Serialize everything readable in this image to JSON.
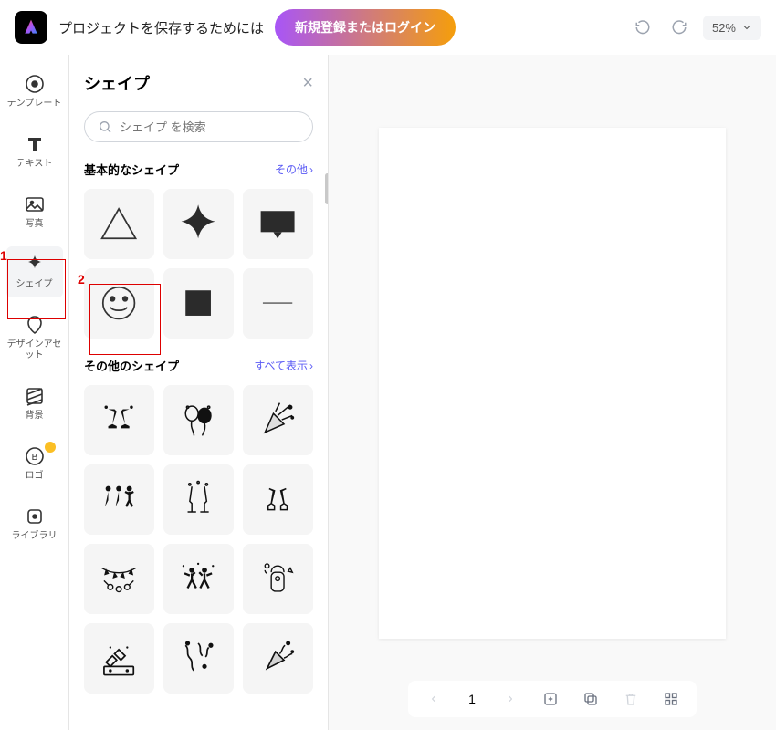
{
  "topbar": {
    "save_msg": "プロジェクトを保存するためには",
    "cta": "新規登録またはログイン",
    "zoom": "52%"
  },
  "rail": {
    "items": [
      {
        "label": "テンプレート"
      },
      {
        "label": "テキスト"
      },
      {
        "label": "写真"
      },
      {
        "label": "シェイプ"
      },
      {
        "label": "デザインアセット"
      },
      {
        "label": "背景"
      },
      {
        "label": "ロゴ"
      },
      {
        "label": "ライブラリ"
      }
    ]
  },
  "panel": {
    "title": "シェイプ",
    "search_placeholder": "シェイプ を検索",
    "sec1_title": "基本的なシェイプ",
    "sec1_link": "その他",
    "sec2_title": "その他のシェイプ",
    "sec2_link": "すべて表示"
  },
  "bottom": {
    "page": "1"
  },
  "annotations": {
    "a1": "1",
    "a2": "2"
  }
}
